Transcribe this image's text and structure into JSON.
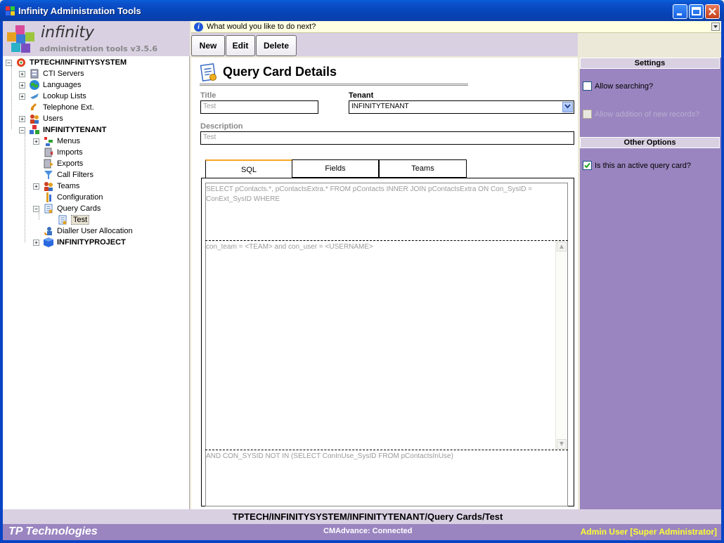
{
  "window": {
    "title": "Infinity Administration Tools",
    "min_label": "_",
    "max_label": "□",
    "close_label": "✕"
  },
  "logo": {
    "name": "infinity",
    "subtitle": "administration tools v3.5.6"
  },
  "info_bar": {
    "text": "What would you like to do next?",
    "icon": "info-icon"
  },
  "toolbar": {
    "new_label": "New",
    "edit_label": "Edit",
    "delete_label": "Delete"
  },
  "tree": {
    "root": "TPTECH/INFINITYSYSTEM",
    "items": [
      {
        "label": "CTI Servers",
        "icon": "server-icon",
        "expander": "+"
      },
      {
        "label": "Languages",
        "icon": "globe-icon",
        "expander": "+"
      },
      {
        "label": "Lookup Lists",
        "icon": "list-icon",
        "expander": "+"
      },
      {
        "label": "Telephone Ext.",
        "icon": "phone-icon",
        "expander": ""
      },
      {
        "label": "Users",
        "icon": "users-icon",
        "expander": "+"
      },
      {
        "label": "INFINITYTENANT",
        "icon": "tenant-icon",
        "expander": "−"
      }
    ],
    "tenant_children": [
      {
        "label": "Menus",
        "icon": "menu-icon",
        "expander": "+"
      },
      {
        "label": "Imports",
        "icon": "import-icon",
        "expander": ""
      },
      {
        "label": "Exports",
        "icon": "export-icon",
        "expander": ""
      },
      {
        "label": "Call Filters",
        "icon": "filter-icon",
        "expander": ""
      },
      {
        "label": "Teams",
        "icon": "teams-icon",
        "expander": "+"
      },
      {
        "label": "Configuration",
        "icon": "config-icon",
        "expander": ""
      },
      {
        "label": "Query Cards",
        "icon": "query-card-icon",
        "expander": "−"
      }
    ],
    "query_card_child": "Test",
    "after_tenant": [
      {
        "label": "Dialler User Allocation",
        "icon": "dialler-icon",
        "expander": ""
      },
      {
        "label": "INFINITYPROJECT",
        "icon": "project-icon",
        "expander": "+"
      }
    ]
  },
  "page": {
    "title": "Query Card Details",
    "title_label": "Title",
    "title_value": "Test",
    "tenant_label": "Tenant",
    "tenant_value": "INFINITYTENANT",
    "description_label": "Description",
    "description_value": "Test"
  },
  "tabs": [
    {
      "label": "SQL",
      "active": true
    },
    {
      "label": "Fields",
      "active": false
    },
    {
      "label": "Teams",
      "active": false
    }
  ],
  "sql": {
    "select_line1": "SELECT pContacts.*, pContactsExtra.* FROM pContacts INNER JOIN pContactsExtra ON Con_SysID =",
    "select_line2": "ConExt_SysID WHERE",
    "where": "con_team = <TEAM> and con_user = <USERNAME>",
    "footer": "AND CON_SYSID NOT IN (SELECT ConInUse_SysID FROM pContactsInUse)"
  },
  "settings": {
    "header": "Settings",
    "allow_searching_label": "Allow searching?",
    "allow_searching": false,
    "allow_addition_label": "Allow addition of new records?",
    "allow_addition": false
  },
  "other_options": {
    "header": "Other Options",
    "active_label": "Is this an active query card?",
    "active": true
  },
  "status": {
    "path": "TPTECH/INFINITYSYSTEM/INFINITYTENANT/Query Cards/Test",
    "company": "TP Technologies",
    "connection": "CMAdvance: Connected",
    "user": "Admin User [Super Administrator]"
  },
  "colors": {
    "accent_purple": "#9a85c0",
    "panel_lavender": "#d9d0e2",
    "xp_blue": "#0844c5",
    "tab_highlight": "#f5a623",
    "user_text": "#ffff33"
  }
}
